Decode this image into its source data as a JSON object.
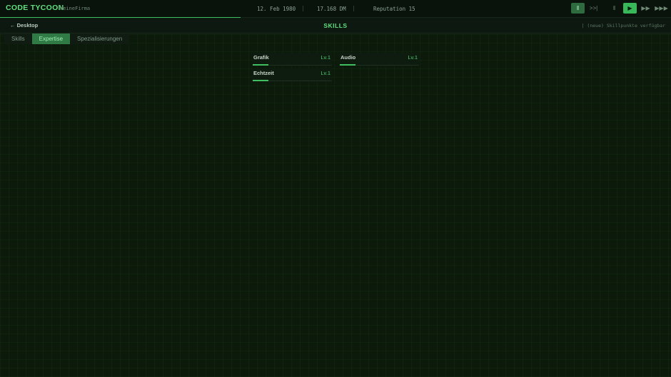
{
  "header": {
    "brand": "CODE TYCOON",
    "company": "MeineFirma",
    "date": "12. Feb 1980",
    "money": "17.168 DM",
    "reputation": "Reputation 15",
    "separator": "|",
    "controls": {
      "pause": "‖",
      "skip": ">>|",
      "pause_alt": "‖",
      "play": "▶",
      "fast": "▶▶",
      "faster": "▶▶▶"
    }
  },
  "subheader": {
    "back_label": "← Desktop",
    "title": "SKILLS",
    "skillpoints": "| (neue) Skillpunkte verfügbar"
  },
  "tabs": [
    {
      "label": "Skills",
      "selected": false
    },
    {
      "label": "Expertise",
      "selected": true
    },
    {
      "label": "Spezialisierungen",
      "selected": false
    }
  ],
  "skills": [
    {
      "name": "Grafik",
      "level": "Lv.1",
      "progress": 0.2
    },
    {
      "name": "Audio",
      "level": "Lv.1",
      "progress": 0.2
    },
    {
      "name": "Echtzeit",
      "level": "Lv.1",
      "progress": 0.2
    }
  ],
  "colors": {
    "accent": "#5fe07f",
    "button_active": "#38b859",
    "button_filled": "#2e6b3e",
    "tab_selected": "#2f7a45",
    "background": "#0b1a0b"
  }
}
